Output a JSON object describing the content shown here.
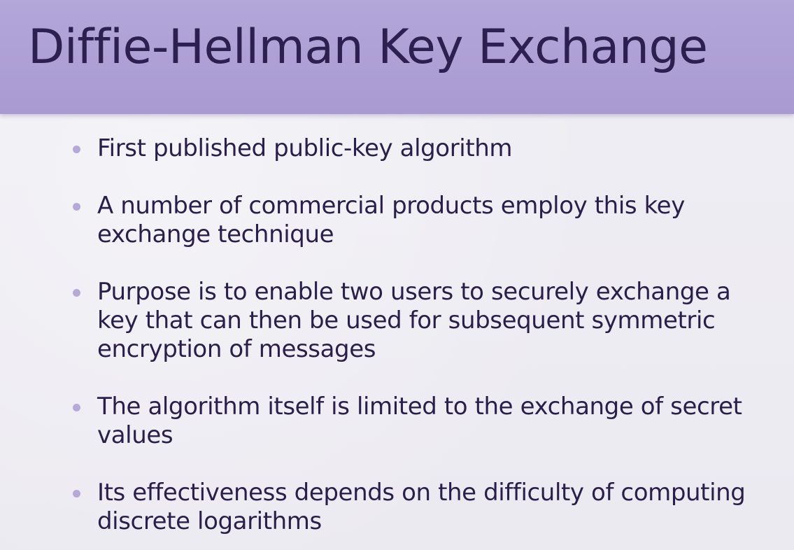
{
  "slide": {
    "title": "Diffie-Hellman Key Exchange",
    "bullets": [
      "First published public-key algorithm",
      "A number of commercial products employ this key exchange technique",
      "Purpose is to enable two users to securely exchange a key that can then be used for subsequent symmetric encryption of messages",
      "The algorithm itself is limited to the exchange of secret values",
      "Its effectiveness depends on the difficulty of computing discrete logarithms"
    ]
  },
  "colors": {
    "title_band": "#aea1d6",
    "title_text": "#2d1f4f",
    "body_text": "#2a1f4a",
    "bullet_dot": "#b6a9d8",
    "background": "#eeecf2"
  }
}
